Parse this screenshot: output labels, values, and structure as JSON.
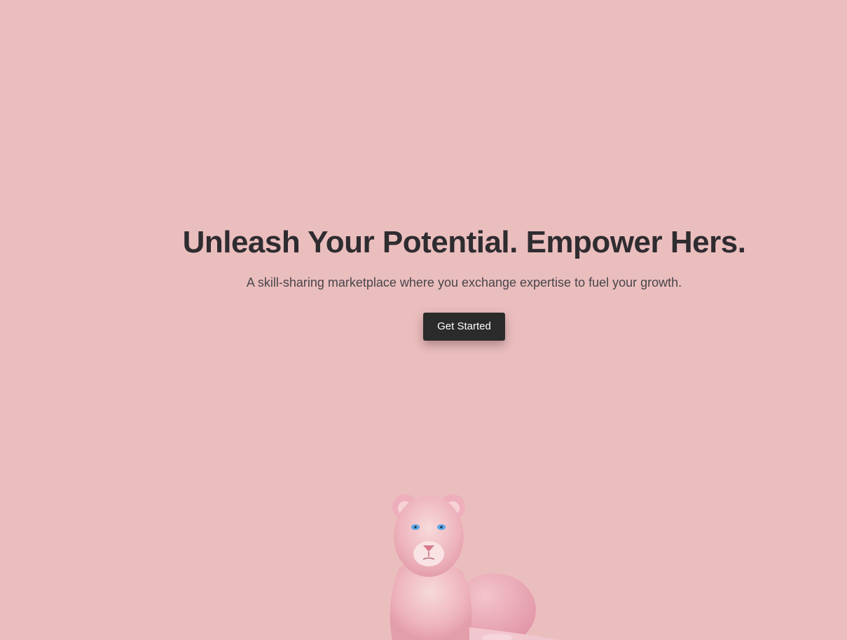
{
  "hero": {
    "headline": "Unleash Your Potential. Empower Hers.",
    "subtitle": "A skill-sharing marketplace where you exchange expertise to fuel your growth.",
    "cta_label": "Get Started"
  },
  "colors": {
    "background": "#ebbebe",
    "headline": "#2e2c30",
    "button": "#2b2b2b",
    "button_text": "#ffffff"
  },
  "illustration": {
    "icon": "pink-lioness-illustration"
  }
}
